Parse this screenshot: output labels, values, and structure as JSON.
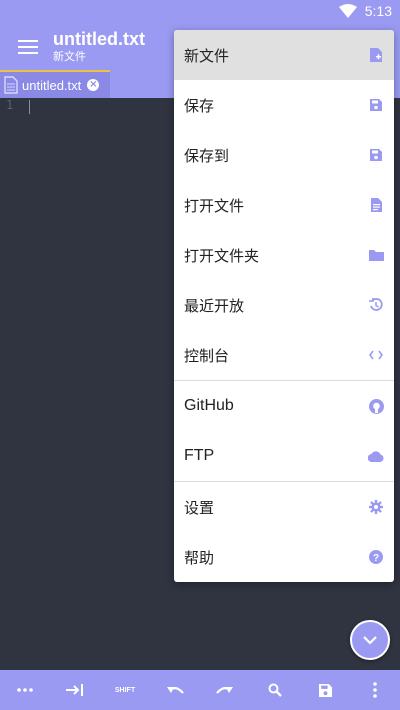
{
  "status": {
    "time": "5:13"
  },
  "appbar": {
    "title": "untitled.txt",
    "subtitle": "新文件"
  },
  "tabs": [
    {
      "label": "untitled.txt"
    }
  ],
  "editor": {
    "line_number": "1"
  },
  "menu": {
    "items": [
      {
        "label": "新文件",
        "icon": "new-file-icon"
      },
      {
        "label": "保存",
        "icon": "save-icon"
      },
      {
        "label": "保存到",
        "icon": "save-as-icon"
      },
      {
        "label": "打开文件",
        "icon": "open-file-icon"
      },
      {
        "label": "打开文件夹",
        "icon": "folder-icon"
      },
      {
        "label": "最近开放",
        "icon": "history-icon"
      },
      {
        "label": "控制台",
        "icon": "code-icon"
      },
      {
        "label": "GitHub",
        "icon": "github-icon"
      },
      {
        "label": "FTP",
        "icon": "cloud-icon"
      },
      {
        "label": "设置",
        "icon": "gear-icon"
      },
      {
        "label": "帮助",
        "icon": "help-icon"
      }
    ]
  },
  "toolbar": {
    "shift_label": "SHIFT"
  },
  "colors": {
    "accent": "#9a9af2",
    "editor_bg": "#2f3440",
    "tab_indicator": "#f0c040"
  }
}
